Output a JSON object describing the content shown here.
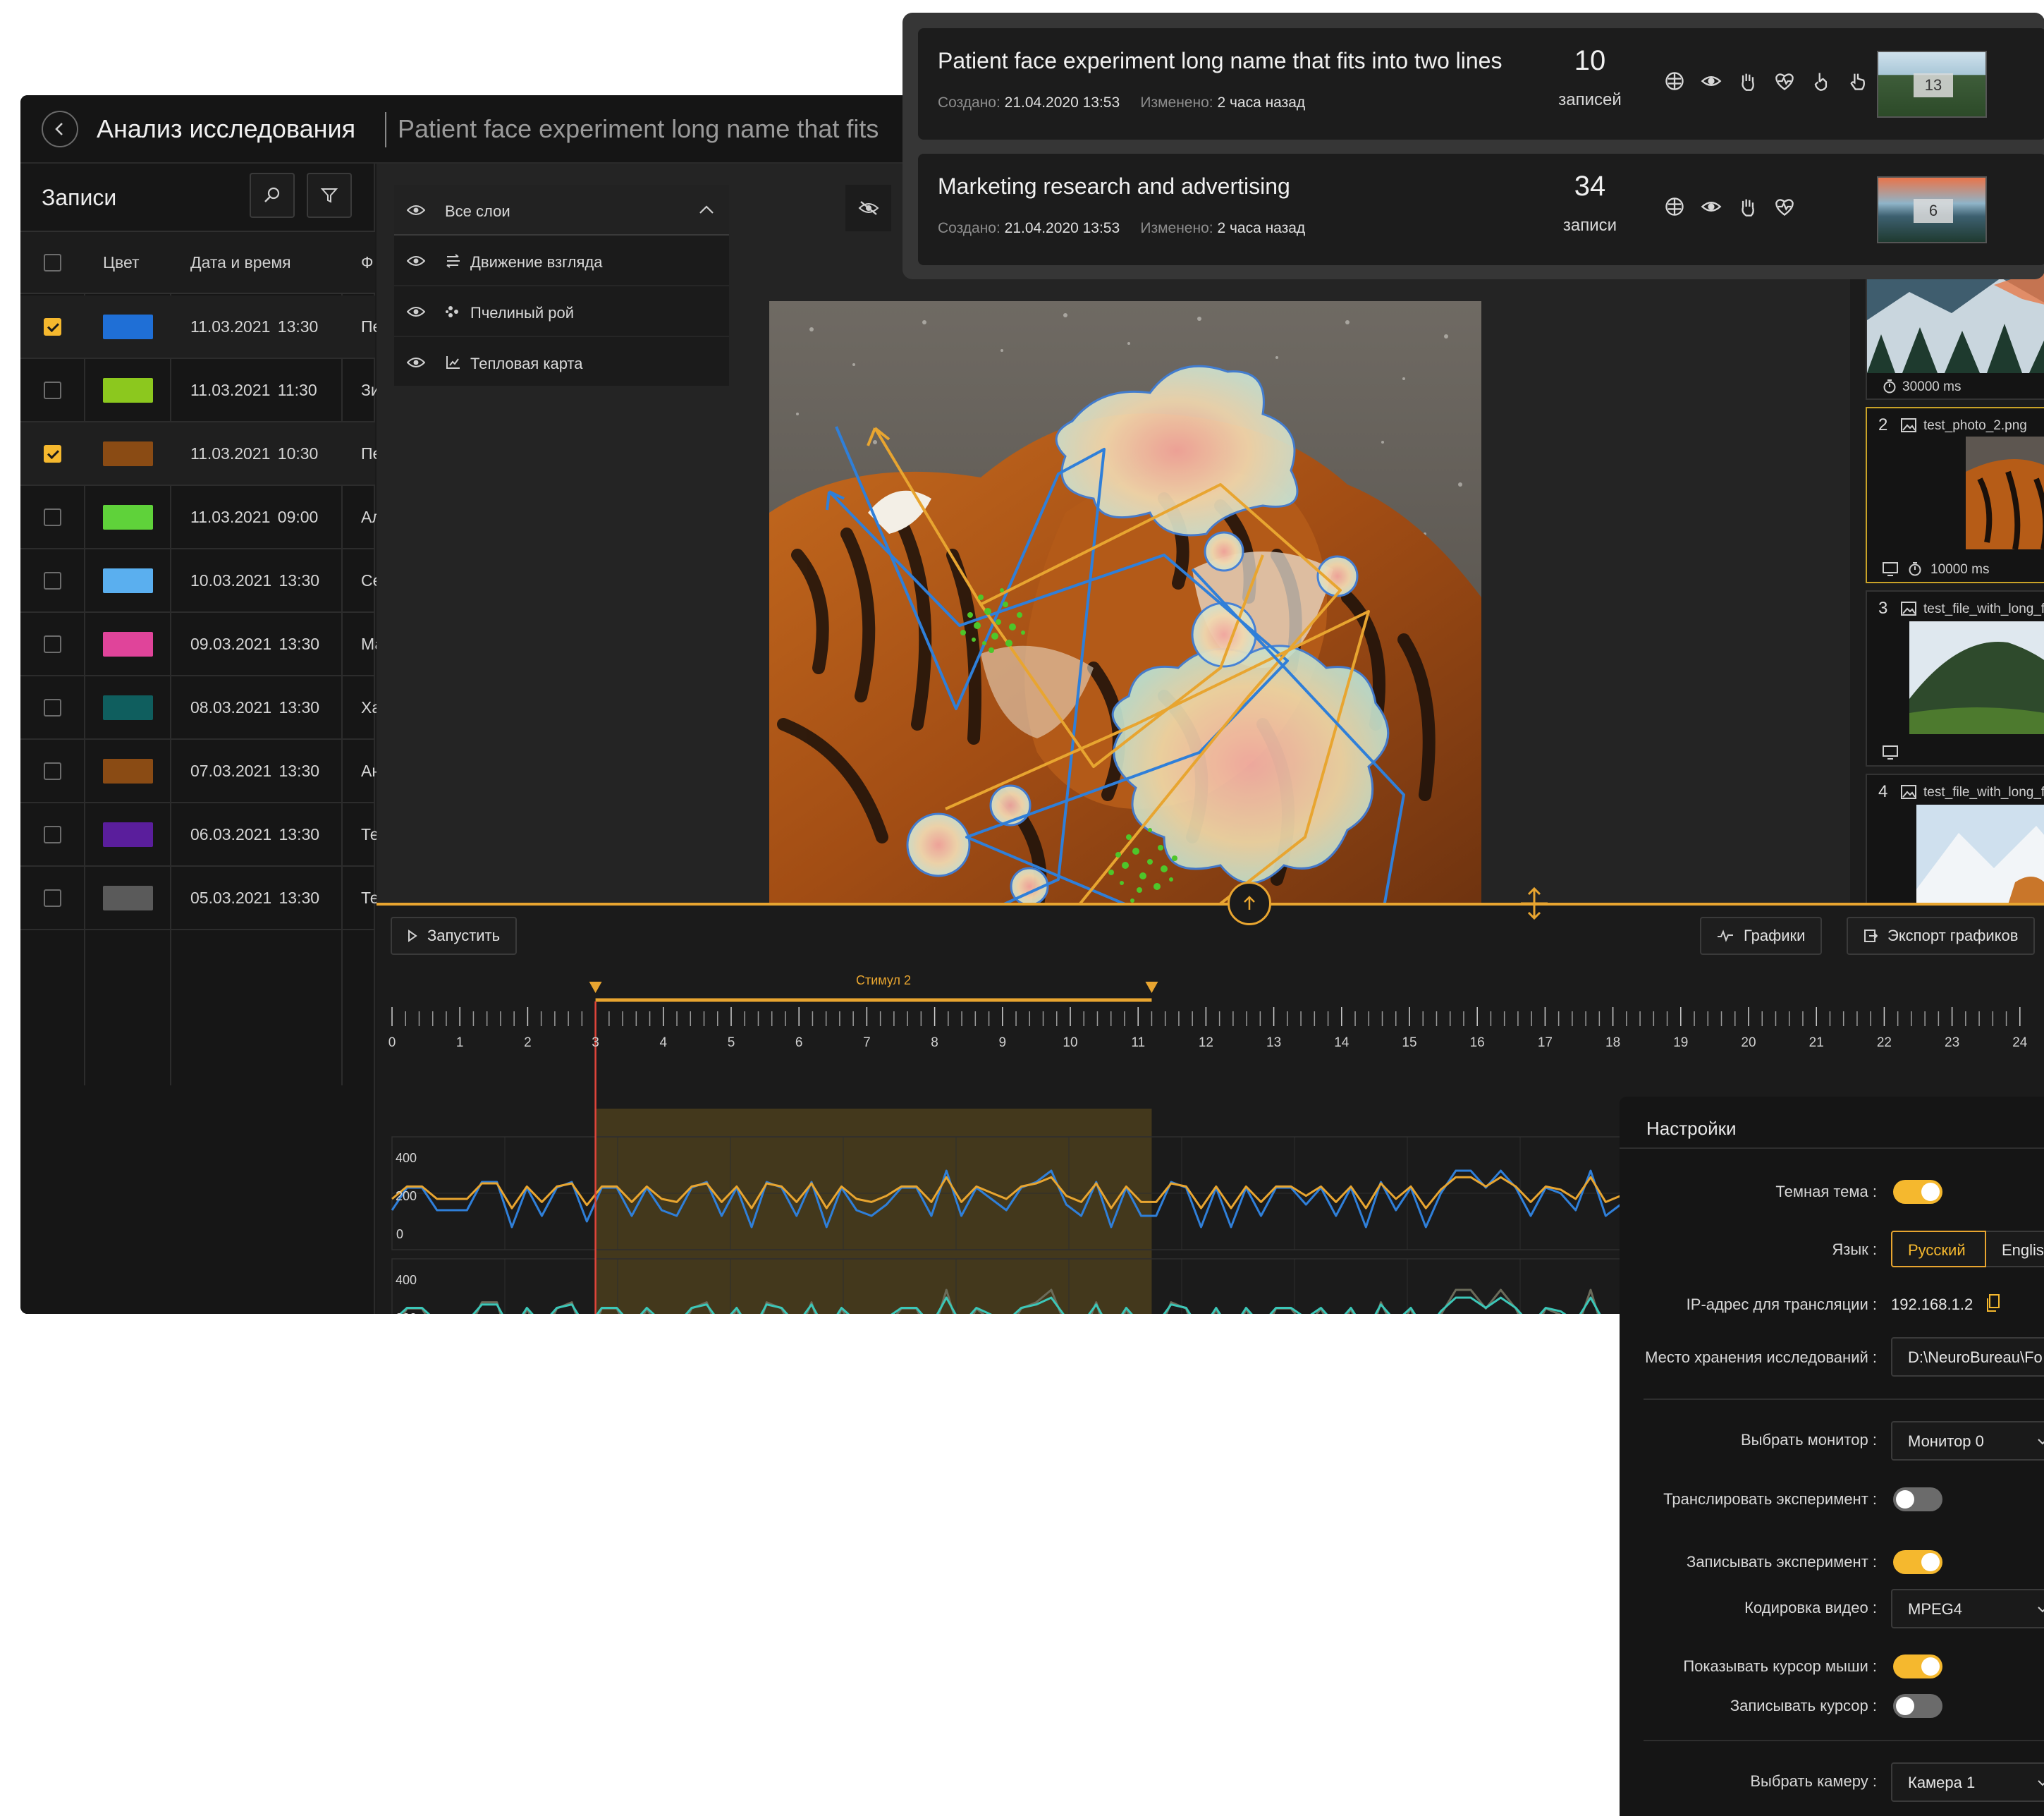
{
  "header": {
    "title": "Анализ исследования",
    "subtitle": "Patient face experiment long name that fits"
  },
  "records": {
    "title": "Записи",
    "columns": [
      "Цвет",
      "Дата и время",
      "Ф"
    ],
    "rows": [
      {
        "checked": true,
        "color": "#1f6fd6",
        "date": "11.03.2021 13:30",
        "trunc": "Пе"
      },
      {
        "checked": false,
        "color": "#8cc81e",
        "date": "11.03.2021 11:30",
        "trunc": "Зи"
      },
      {
        "checked": true,
        "color": "#8a4b14",
        "date": "11.03.2021 10:30",
        "trunc": "Пе"
      },
      {
        "checked": false,
        "color": "#5fd23a",
        "date": "11.03.2021 09:00",
        "trunc": "Ал"
      },
      {
        "checked": false,
        "color": "#5aafef",
        "date": "10.03.2021 13:30",
        "trunc": "Се"
      },
      {
        "checked": false,
        "color": "#e0449a",
        "date": "09.03.2021 13:30",
        "trunc": "Ма"
      },
      {
        "checked": false,
        "color": "#0f5e5e",
        "date": "08.03.2021 13:30",
        "trunc": "Ха"
      },
      {
        "checked": false,
        "color": "#8a4b14",
        "date": "07.03.2021 13:30",
        "trunc": "Ан"
      },
      {
        "checked": false,
        "color": "#5a1e9c",
        "date": "06.03.2021 13:30",
        "trunc": "Те"
      },
      {
        "checked": false,
        "color": "#5a5a5a",
        "date": "05.03.2021 13:30",
        "trunc": "Те"
      }
    ]
  },
  "layers": {
    "header": "Все слои",
    "items": [
      {
        "label": "Движение взгляда",
        "icon": "gaze-path-icon"
      },
      {
        "label": "Пчелиный рой",
        "icon": "bee-swarm-icon"
      },
      {
        "label": "Тепловая карта",
        "icon": "heatmap-icon"
      }
    ]
  },
  "thumbs": [
    {
      "num": "",
      "name": "",
      "time": "30000 ms"
    },
    {
      "num": "2",
      "name": "test_photo_2.png",
      "time": "10000 ms"
    },
    {
      "num": "3",
      "name": "test_file_with_long_fil",
      "time": ""
    },
    {
      "num": "4",
      "name": "test_file_with_long_fil",
      "time": ""
    }
  ],
  "timeline": {
    "run_label": "Запустить",
    "charts_label": "Графики",
    "export_label": "Экспорт графиков",
    "stimulus_label": "Стимул 2",
    "ticks": [
      "0",
      "1",
      "2",
      "3",
      "4",
      "5",
      "6",
      "7",
      "8",
      "9",
      "10",
      "11",
      "12",
      "13",
      "14",
      "15",
      "16",
      "17",
      "18",
      "19",
      "20",
      "21",
      "22",
      "23",
      "24"
    ],
    "y_ticks": [
      "400",
      "200",
      "0"
    ]
  },
  "cards": [
    {
      "title": "Patient face experiment long name that fits into two lines",
      "created_label": "Создано:",
      "created": "21.04.2020  13:53",
      "modified_label": "Изменено:",
      "modified": "2 часа назад",
      "count": "10",
      "count_label": "записей",
      "thumb_badge": "13",
      "icons": [
        "brain-icon",
        "eye-icon",
        "hand-icon",
        "heart-rate-icon",
        "pointer-hand-icon",
        "gesture-icon"
      ]
    },
    {
      "title": "Marketing research and advertising",
      "created_label": "Создано:",
      "created": "21.04.2020  13:53",
      "modified_label": "Изменено:",
      "modified": "2 часа назад",
      "count": "34",
      "count_label": "записи",
      "thumb_badge": "6",
      "icons": [
        "brain-icon",
        "eye-icon",
        "hand-icon",
        "heart-rate-icon"
      ]
    }
  ],
  "settings": {
    "title": "Настройки",
    "dark_theme_label": "Темная тема :",
    "dark_theme": true,
    "language_label": "Язык :",
    "language_options": [
      "Русский",
      "Englis"
    ],
    "language_selected": "Русский",
    "ip_label": "IP-адрес для трансляции :",
    "ip": "192.168.1.2",
    "storage_label": "Место хранения исследований :",
    "storage": "D:\\NeuroBureau\\Fo",
    "monitor_label": "Выбрать монитор :",
    "monitor": "Монитор 0",
    "broadcast_label": "Транслировать эксперимент :",
    "broadcast": false,
    "record_label": "Записывать эксперимент :",
    "record": true,
    "codec_label": "Кодировка видео :",
    "codec": "MPEG4",
    "show_cursor_label": "Показывать курсор мыши :",
    "show_cursor": true,
    "record_cursor_label": "Записывать курсор :",
    "record_cursor": false,
    "camera_label": "Выбрать камеру :",
    "camera": "Камера 1"
  },
  "colors": {
    "accent": "#f5b82e",
    "gaze_blue": "#2f7fd9",
    "gaze_orange": "#e8a530",
    "swarm_green": "#4ec62a"
  }
}
